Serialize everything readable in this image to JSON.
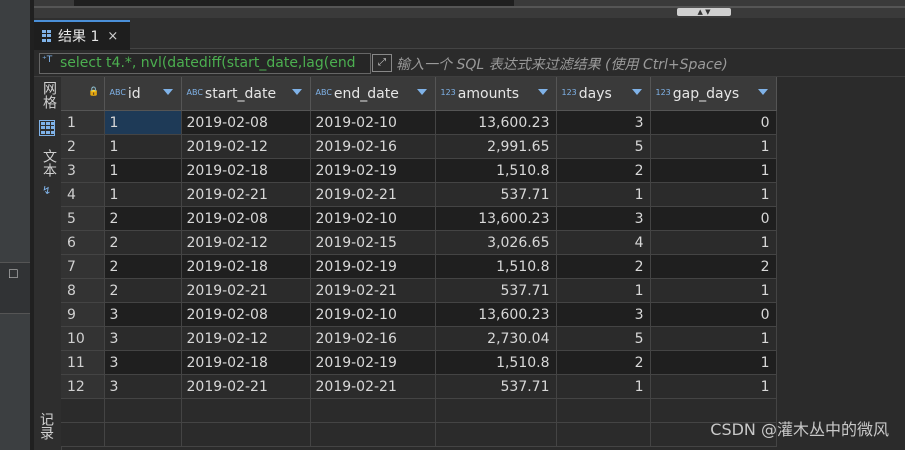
{
  "results_tab": {
    "label": "结果 1",
    "close": "×"
  },
  "filter": {
    "query": "select t4.*, nvl(datediff(start_date,lag(end",
    "placeholder": "输入一个 SQL 表达式来过滤结果 (使用 Ctrl+Space)"
  },
  "side": {
    "grid_label": "网格",
    "text_label": "文本",
    "records_label": "记录"
  },
  "columns": [
    {
      "type": "ABC",
      "name": "id"
    },
    {
      "type": "ABC",
      "name": "start_date"
    },
    {
      "type": "ABC",
      "name": "end_date"
    },
    {
      "type": "123",
      "name": "amounts"
    },
    {
      "type": "123",
      "name": "days"
    },
    {
      "type": "123",
      "name": "gap_days"
    }
  ],
  "rows": [
    {
      "n": "1",
      "id": "1",
      "start_date": "2019-02-08",
      "end_date": "2019-02-10",
      "amounts": "13,600.23",
      "days": "3",
      "gap_days": "0"
    },
    {
      "n": "2",
      "id": "1",
      "start_date": "2019-02-12",
      "end_date": "2019-02-16",
      "amounts": "2,991.65",
      "days": "5",
      "gap_days": "1"
    },
    {
      "n": "3",
      "id": "1",
      "start_date": "2019-02-18",
      "end_date": "2019-02-19",
      "amounts": "1,510.8",
      "days": "2",
      "gap_days": "1"
    },
    {
      "n": "4",
      "id": "1",
      "start_date": "2019-02-21",
      "end_date": "2019-02-21",
      "amounts": "537.71",
      "days": "1",
      "gap_days": "1"
    },
    {
      "n": "5",
      "id": "2",
      "start_date": "2019-02-08",
      "end_date": "2019-02-10",
      "amounts": "13,600.23",
      "days": "3",
      "gap_days": "0"
    },
    {
      "n": "6",
      "id": "2",
      "start_date": "2019-02-12",
      "end_date": "2019-02-15",
      "amounts": "3,026.65",
      "days": "4",
      "gap_days": "1"
    },
    {
      "n": "7",
      "id": "2",
      "start_date": "2019-02-18",
      "end_date": "2019-02-19",
      "amounts": "1,510.8",
      "days": "2",
      "gap_days": "2"
    },
    {
      "n": "8",
      "id": "2",
      "start_date": "2019-02-21",
      "end_date": "2019-02-21",
      "amounts": "537.71",
      "days": "1",
      "gap_days": "1"
    },
    {
      "n": "9",
      "id": "3",
      "start_date": "2019-02-08",
      "end_date": "2019-02-10",
      "amounts": "13,600.23",
      "days": "3",
      "gap_days": "0"
    },
    {
      "n": "10",
      "id": "3",
      "start_date": "2019-02-12",
      "end_date": "2019-02-16",
      "amounts": "2,730.04",
      "days": "5",
      "gap_days": "1"
    },
    {
      "n": "11",
      "id": "3",
      "start_date": "2019-02-18",
      "end_date": "2019-02-19",
      "amounts": "1,510.8",
      "days": "2",
      "gap_days": "1"
    },
    {
      "n": "12",
      "id": "3",
      "start_date": "2019-02-21",
      "end_date": "2019-02-21",
      "amounts": "537.71",
      "days": "1",
      "gap_days": "1"
    }
  ],
  "watermark": "CSDN @灌木丛中的微风",
  "colors": {
    "accent": "#4a8fd8",
    "sql_text": "#4caf50",
    "selection": "#1e3a57"
  }
}
